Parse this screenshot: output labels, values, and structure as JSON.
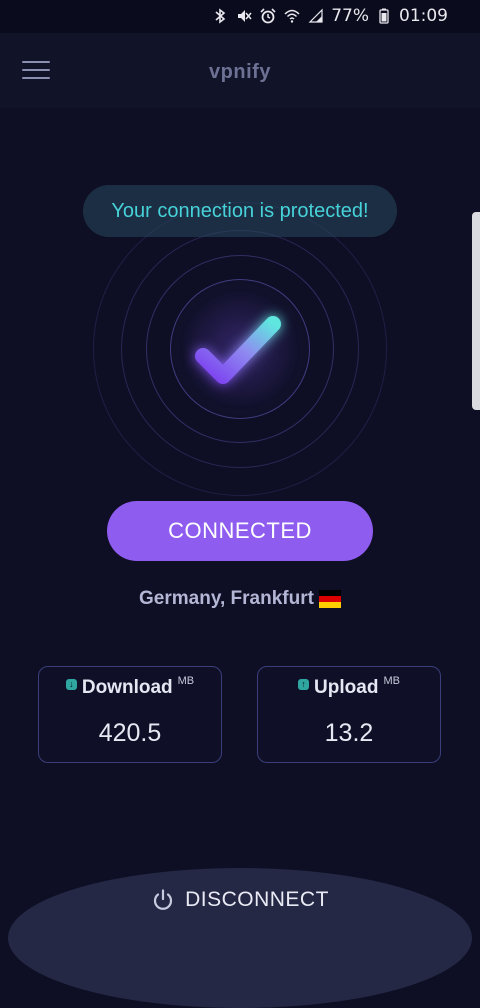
{
  "status_bar": {
    "battery_percent": "77%",
    "time": "01:09",
    "icons": [
      "bluetooth-icon",
      "mute-icon",
      "alarm-icon",
      "wifi-icon",
      "signal-icon",
      "battery-icon"
    ]
  },
  "header": {
    "title": "vpnify",
    "menu_icon": "hamburger-menu-icon"
  },
  "status_message": "Your connection is protected!",
  "connection_button": {
    "label": "CONNECTED"
  },
  "location": {
    "name": "Germany, Frankfurt",
    "flag": "germany-flag",
    "flag_colors": [
      "#000000",
      "#dd0000",
      "#ffce00"
    ]
  },
  "stats": {
    "download": {
      "label": "Download",
      "unit": "MB",
      "value": "420.5",
      "icon": "download-icon"
    },
    "upload": {
      "label": "Upload",
      "unit": "MB",
      "value": "13.2",
      "icon": "upload-icon"
    }
  },
  "disconnect_button": {
    "label": "DISCONNECT",
    "icon": "power-icon"
  },
  "colors": {
    "background": "#0e0f24",
    "accent": "#8f5cf0",
    "protected_text": "#46d2d8",
    "stat_icon": "#2fa6a0"
  }
}
